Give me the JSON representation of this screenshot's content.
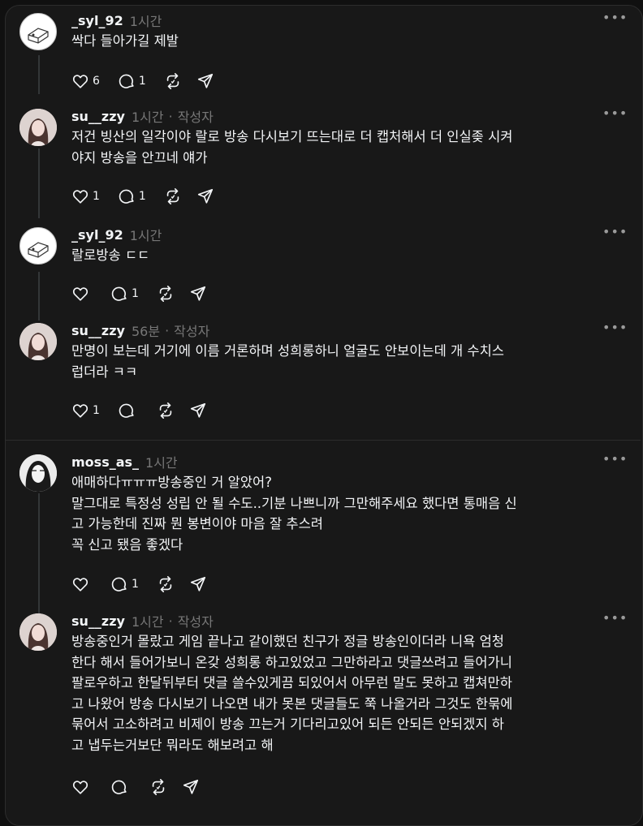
{
  "posts": [
    {
      "username": "_syl_92",
      "time": "1시간",
      "author_tag": "",
      "body": "싹다 들아가길 제발",
      "likes": "6",
      "replies": "1"
    },
    {
      "username": "su__zzy",
      "time": "1시간",
      "author_tag": "작성자",
      "body": "저건 빙산의 일각이야 랄로 방송 다시보기 뜨는대로 더 캡처해서 더 인실좆 시켜\n야지 방송을 안끄네 얘가",
      "likes": "1",
      "replies": "1"
    },
    {
      "username": "_syl_92",
      "time": "1시간",
      "author_tag": "",
      "body": "랄로방송 ㄷㄷ",
      "likes": "",
      "replies": "1"
    },
    {
      "username": "su__zzy",
      "time": "56분",
      "author_tag": "작성자",
      "body": "만명이 보는데 거기에 이름 거론하며 성희롱하니 얼굴도 안보이는데 개 수치스\n럽더라 ㅋㅋ",
      "likes": "1",
      "replies": ""
    },
    {
      "username": "moss_as_",
      "time": "1시간",
      "author_tag": "",
      "body": "애매하다ㅠㅠㅠ방송중인 거 알았어?\n말그대로 특정성 성립 안 될 수도..기분 나쁘니까 그만해주세요 했다면 통매음 신\n고 가능한데 진짜 뭔 봉변이야 마음 잘 추스려\n꼭 신고 됐음 좋겠다",
      "likes": "",
      "replies": "1"
    },
    {
      "username": "su__zzy",
      "time": "1시간",
      "author_tag": "작성자",
      "body": "방송중인거 몰랐고 게임 끝나고 같이했던 친구가 정글 방송인이더라 니욕 엄청\n한다 해서 들어가보니 온갖 성희롱 하고있었고 그만하라고 댓글쓰려고 들어가니\n팔로우하고 한달뒤부터 댓글 쓸수있게끔 되있어서 아무런 말도 못하고 캡쳐만하\n고 나왔어 방송 다시보기 나오면 내가 못본 댓글들도 쭉 나올거라 그것도 한묶에\n묶어서 고소하려고 비제이 방송 끄는거 기다리고있어 되든 안되든 안되겠지 하\n고 냅두는거보단 뭐라도 해보려고 해",
      "likes": "",
      "replies": ""
    }
  ],
  "icons": {
    "like": "heart-icon",
    "reply": "comment-icon",
    "repost": "repost-icon",
    "share": "share-icon",
    "more": "more-icon"
  }
}
